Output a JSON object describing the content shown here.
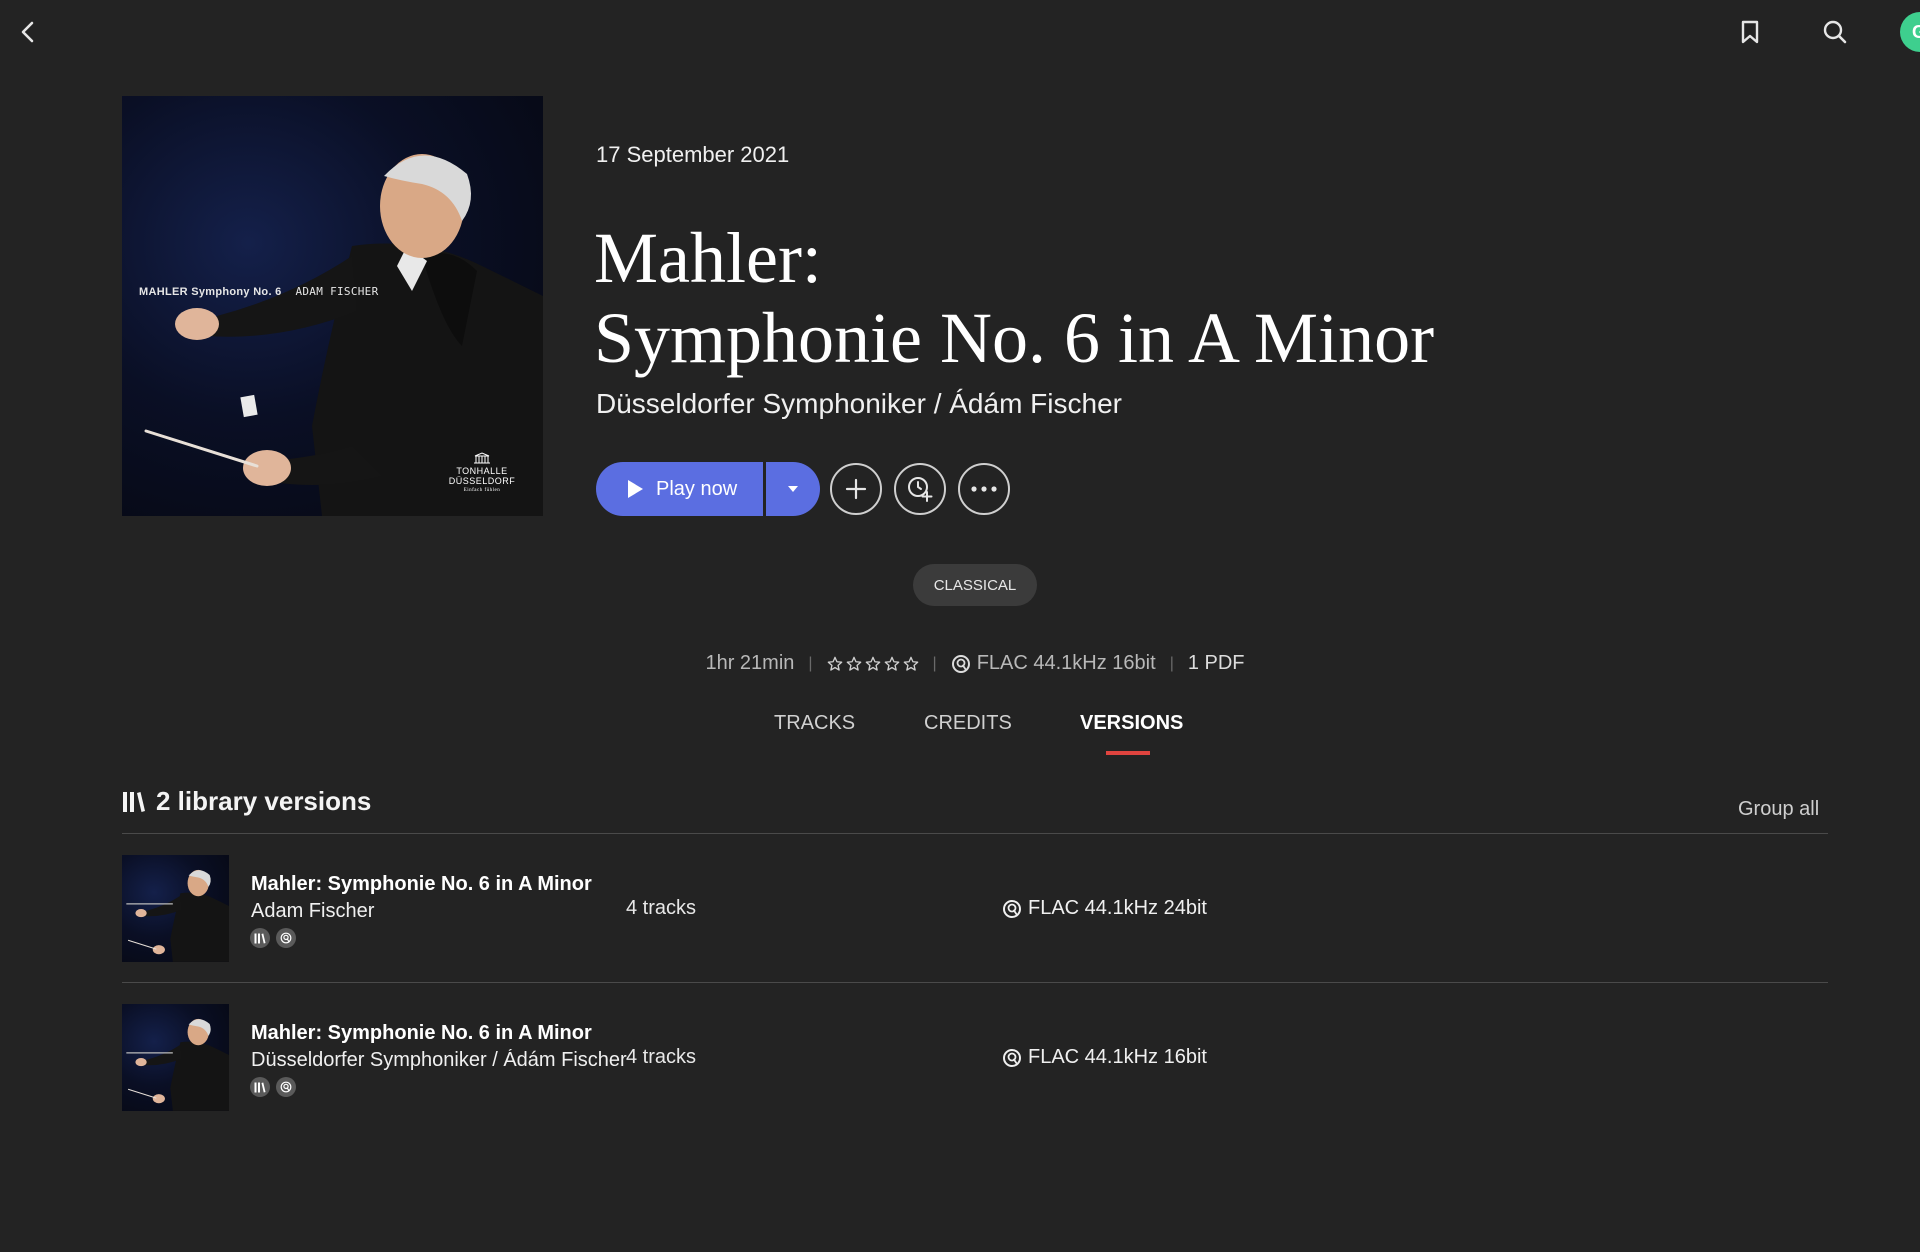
{
  "header": {
    "icons": [
      "chevron-left-icon",
      "bookmark-icon",
      "search-icon"
    ],
    "avatar_initial": "G",
    "avatar_color": "#3ecf8e"
  },
  "cover": {
    "title_text": "MAHLER Symphony No. 6",
    "artist_text": "ADAM FISCHER",
    "logo_line1": "TONHALLE",
    "logo_line2": "DÜSSELDORF",
    "logo_line3": "Einfach fühlen"
  },
  "album": {
    "release_date": "17 September 2021",
    "title_line1": "Mahler:",
    "title_line2": "Symphonie No. 6 in A Minor",
    "artist": "Düsseldorfer Symphoniker / Ádám Fischer"
  },
  "actions": {
    "play_label": "Play now",
    "accent_color": "#5b6ee1",
    "icons": [
      "play-icon",
      "chevron-down-icon",
      "plus-icon",
      "clock-plus-icon",
      "more-icon"
    ]
  },
  "genre": "CLASSICAL",
  "meta": {
    "duration": "1hr 21min",
    "rating_stars": 0,
    "rating_max": 5,
    "format": "FLAC 44.1kHz 16bit",
    "attachments": "1 PDF"
  },
  "tabs": [
    {
      "label": "TRACKS",
      "active": false
    },
    {
      "label": "CREDITS",
      "active": false
    },
    {
      "label": "VERSIONS",
      "active": true
    }
  ],
  "tab_underline_color": "#e0443f",
  "versions": {
    "header": "2 library versions",
    "group_all": "Group all",
    "items": [
      {
        "title": "Mahler: Symphonie No. 6 in A Minor",
        "artist": "Adam Fischer",
        "tracks": "4 tracks",
        "format": "FLAC 44.1kHz 24bit"
      },
      {
        "title": "Mahler: Symphonie No. 6 in A Minor",
        "artist": "Düsseldorfer Symphoniker / Ádám Fischer",
        "tracks": "4 tracks",
        "format": "FLAC 44.1kHz 16bit"
      }
    ]
  }
}
